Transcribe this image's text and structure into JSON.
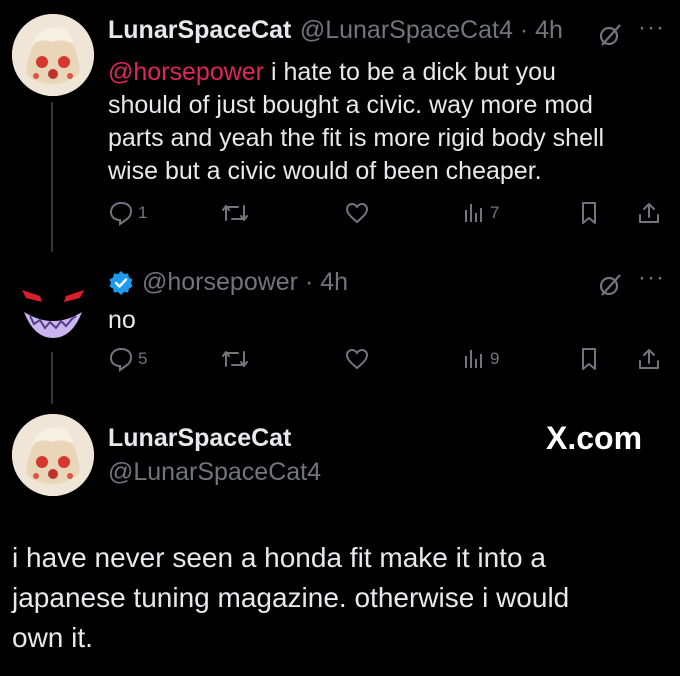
{
  "tweet1": {
    "display_name": "LunarSpaceCat",
    "handle_time": "@LunarSpaceCat4 · 4h",
    "mention": "@horsepower",
    "lines": [
      " i hate to be a dick but you",
      "should of just bought a civic. way more mod",
      "parts and yeah the fit is more rigid body shell",
      "wise but a civic would of been cheaper."
    ],
    "replies": "1",
    "views": "7"
  },
  "tweet2": {
    "handle_time": "@horsepower · 4h",
    "text": "no",
    "replies": "5",
    "views": "9"
  },
  "tweet3": {
    "display_name": "LunarSpaceCat",
    "handle": "@LunarSpaceCat4",
    "watermark": "X.com",
    "lines": [
      "i have never seen a honda fit make it into a",
      "japanese tuning magazine. otherwise i would",
      "own it."
    ]
  },
  "icons": {
    "reply": "reply-icon",
    "retweet": "retweet-icon",
    "like": "heart-icon",
    "views": "views-icon",
    "bookmark": "bookmark-icon",
    "share": "share-icon",
    "grok": "grok-icon",
    "more": "more-icon",
    "verified": "verified-badge-icon"
  },
  "colors": {
    "background": "#000000",
    "text": "#e7e9ea",
    "muted": "#71767b",
    "mention": "#e0245e",
    "verified": "#1d9bf0"
  }
}
